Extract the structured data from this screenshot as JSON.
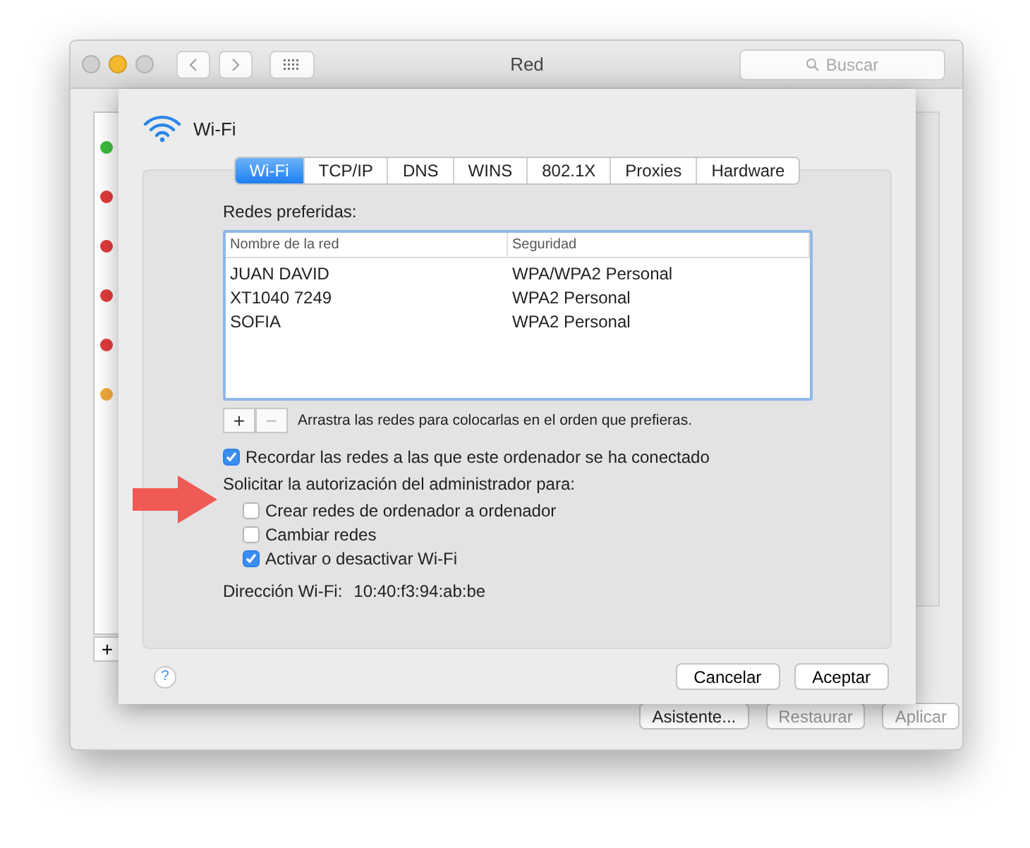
{
  "window": {
    "title": "Red",
    "search": {
      "placeholder": "Buscar"
    }
  },
  "sidebar": {
    "items": [
      {
        "color": "#3dbb3d"
      },
      {
        "color": "#e23b3b"
      },
      {
        "color": "#e23b3b"
      },
      {
        "color": "#e23b3b"
      },
      {
        "color": "#e23b3b"
      },
      {
        "color": "#f2a93b"
      }
    ],
    "add": "+"
  },
  "bottom_buttons": [
    {
      "label": "Asistente...",
      "disabled": false
    },
    {
      "label": "Restaurar",
      "disabled": true
    },
    {
      "label": "Aplicar",
      "disabled": true
    }
  ],
  "sheet": {
    "title": "Wi-Fi",
    "tabs": [
      {
        "label": "Wi-Fi",
        "selected": true
      },
      {
        "label": "TCP/IP",
        "selected": false
      },
      {
        "label": "DNS",
        "selected": false
      },
      {
        "label": "WINS",
        "selected": false
      },
      {
        "label": "802.1X",
        "selected": false
      },
      {
        "label": "Proxies",
        "selected": false
      },
      {
        "label": "Hardware",
        "selected": false
      }
    ],
    "list_label": "Redes preferidas:",
    "table": {
      "columns": [
        "Nombre de la red",
        "Seguridad"
      ],
      "rows": [
        [
          "JUAN DAVID",
          "WPA/WPA2 Personal"
        ],
        [
          "XT1040 7249",
          "WPA2 Personal"
        ],
        [
          "SOFIA",
          "WPA2 Personal"
        ]
      ]
    },
    "list_buttons": [
      {
        "label": "+",
        "disabled": false
      },
      {
        "label": "−",
        "disabled": true
      }
    ],
    "hint": "Arrastra las redes para colocarlas en el orden que prefieras.",
    "remember": {
      "label": "Recordar las redes a las que este ordenador se ha conectado",
      "checked": true
    },
    "admin_label": "Solicitar la autorización del administrador para:",
    "admin_options": [
      {
        "label": "Crear redes de ordenador a ordenador",
        "checked": false
      },
      {
        "label": "Cambiar redes",
        "checked": false
      },
      {
        "label": "Activar o desactivar Wi-Fi",
        "checked": true
      }
    ],
    "address_label": "Dirección Wi-Fi:",
    "address_value": "10:40:f3:94:ab:be",
    "help": "?",
    "buttons": [
      "Cancelar",
      "Aceptar"
    ]
  }
}
